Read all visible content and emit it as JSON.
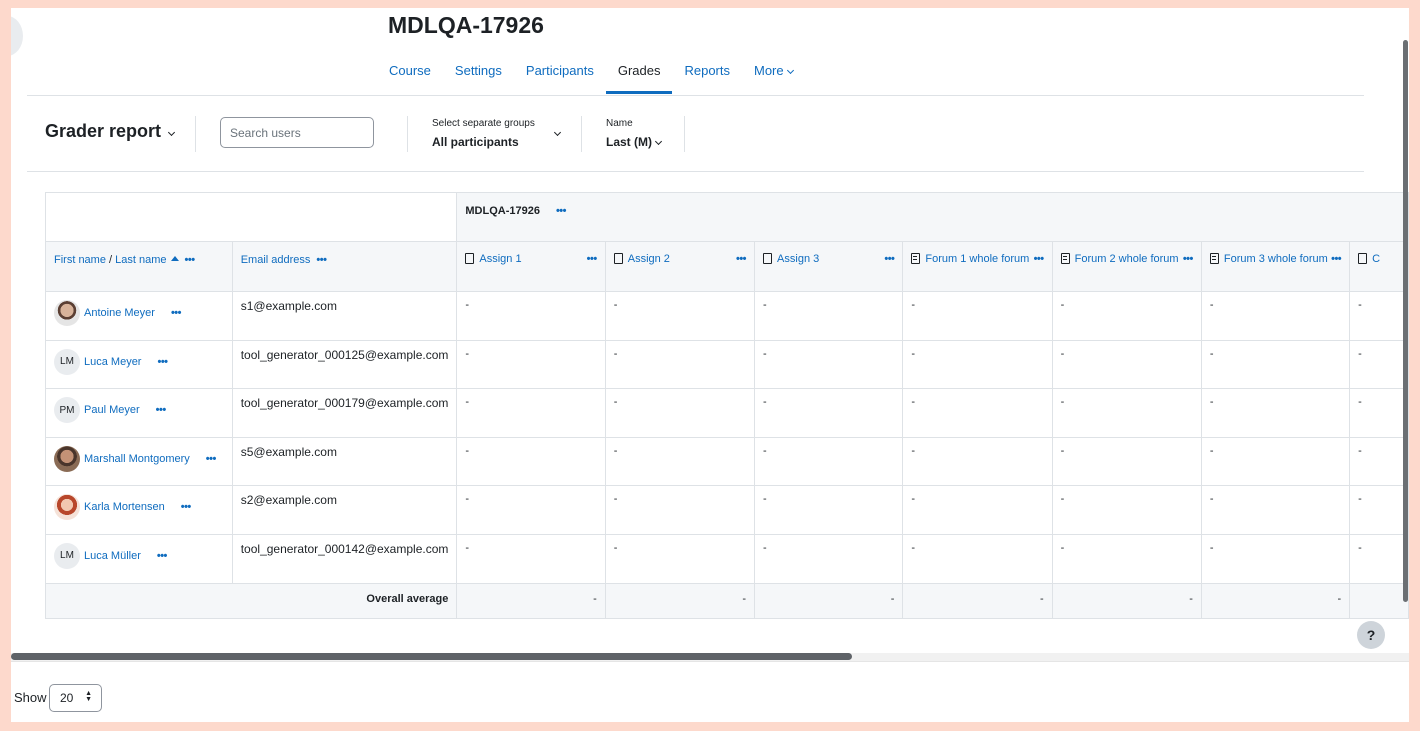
{
  "course": {
    "title": "MDLQA-17926",
    "nav": [
      {
        "label": "Course",
        "active": false
      },
      {
        "label": "Settings",
        "active": false
      },
      {
        "label": "Participants",
        "active": false
      },
      {
        "label": "Grades",
        "active": true
      },
      {
        "label": "Reports",
        "active": false
      },
      {
        "label": "More",
        "active": false
      }
    ]
  },
  "toolbar": {
    "report_title": "Grader report",
    "search_placeholder": "Search users",
    "groups_label": "Select separate groups",
    "groups_value": "All participants",
    "name_label": "Name",
    "name_value": "Last (M)"
  },
  "table": {
    "category": "MDLQA-17926",
    "col_first": "First name",
    "col_sep": " / ",
    "col_last": "Last name",
    "col_email": "Email address",
    "items": [
      {
        "label": "Assign 1",
        "type": "assign"
      },
      {
        "label": "Assign 2",
        "type": "assign"
      },
      {
        "label": "Assign 3",
        "type": "assign"
      },
      {
        "label": "Forum 1 whole forum",
        "type": "forum"
      },
      {
        "label": "Forum 2 whole forum",
        "type": "forum"
      },
      {
        "label": "Forum 3 whole forum",
        "type": "forum"
      },
      {
        "label": "C",
        "type": "check"
      }
    ],
    "rows": [
      {
        "name": "Antoine Meyer",
        "initials": "",
        "photo": "photo1",
        "email": "s1@example.com",
        "grades": [
          "-",
          "-",
          "-",
          "-",
          "-",
          "-",
          "-"
        ]
      },
      {
        "name": "Luca Meyer",
        "initials": "LM",
        "photo": "",
        "email": "tool_generator_000125@example.com",
        "grades": [
          "-",
          "-",
          "-",
          "-",
          "-",
          "-",
          "-"
        ]
      },
      {
        "name": "Paul Meyer",
        "initials": "PM",
        "photo": "",
        "email": "tool_generator_000179@example.com",
        "grades": [
          "-",
          "-",
          "-",
          "-",
          "-",
          "-",
          "-"
        ]
      },
      {
        "name": "Marshall Montgomery",
        "initials": "",
        "photo": "photo2",
        "email": "s5@example.com",
        "grades": [
          "-",
          "-",
          "-",
          "-",
          "-",
          "-",
          "-"
        ]
      },
      {
        "name": "Karla Mortensen",
        "initials": "",
        "photo": "photo3",
        "email": "s2@example.com",
        "grades": [
          "-",
          "-",
          "-",
          "-",
          "-",
          "-",
          "-"
        ]
      },
      {
        "name": "Luca Müller",
        "initials": "LM",
        "photo": "",
        "email": "tool_generator_000142@example.com",
        "grades": [
          "-",
          "-",
          "-",
          "-",
          "-",
          "-",
          "-"
        ]
      }
    ],
    "overall_label": "Overall average",
    "overall_values": [
      "-",
      "-",
      "-",
      "-",
      "-",
      "-",
      ""
    ]
  },
  "footer": {
    "show_label": "Show",
    "per_page": "20",
    "help": "?"
  },
  "colors": {
    "link": "#0f6cbf",
    "header_bg": "#f5f7f9",
    "border": "#dee2e6"
  }
}
